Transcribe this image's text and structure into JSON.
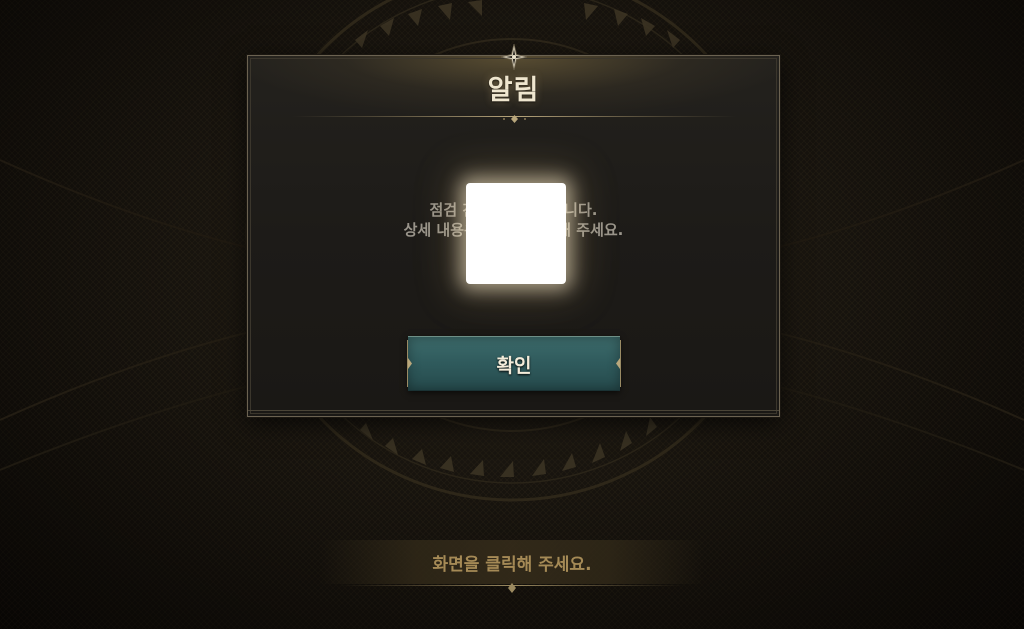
{
  "dialog": {
    "title": "알림",
    "message_line_1": "점검 진행으로 종료됩니다.",
    "message_line_2": "상세 내용은 공지를 확인해 주세요.",
    "confirm_label": "확인"
  },
  "hint": {
    "text": "화면을 클릭해 주세요."
  },
  "colors": {
    "title": "#efe6cf",
    "message": "#9a958b",
    "button": "#2f5a5c",
    "hint": "#a58a56",
    "frame_border": "#6b6251"
  },
  "icons": {
    "top_ornament": "four-point-star-ornament",
    "divider_ornament": "diamond-ornament",
    "button_edge": "leaf-flourish"
  }
}
